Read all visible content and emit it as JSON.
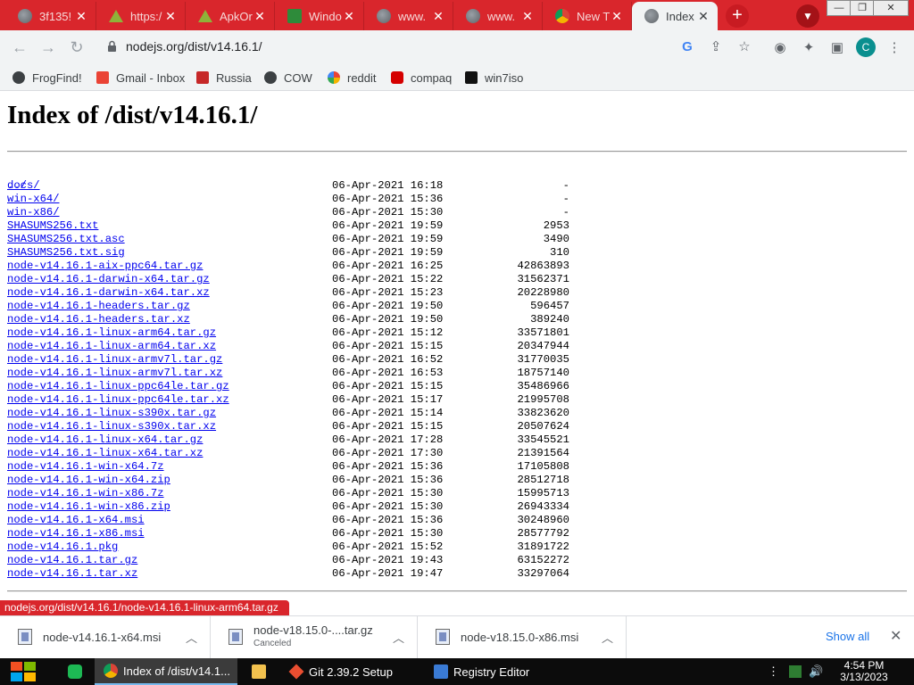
{
  "browser": {
    "tabs": [
      {
        "title": "3f135!",
        "icon": "globe-icon",
        "active": false
      },
      {
        "title": "https:/",
        "icon": "apk-icon",
        "active": false
      },
      {
        "title": "ApkOr",
        "icon": "apk-icon",
        "active": false
      },
      {
        "title": "Windo",
        "icon": "windows-icon",
        "active": false
      },
      {
        "title": "www.",
        "icon": "globe-icon",
        "active": false
      },
      {
        "title": "www.",
        "icon": "globe-icon",
        "active": false
      },
      {
        "title": "New T",
        "icon": "chrome-icon",
        "active": false
      },
      {
        "title": "Index",
        "icon": "globe-icon",
        "active": true
      }
    ],
    "url": "nodejs.org/dist/v14.16.1/",
    "profile_initial": "C",
    "bookmarks": [
      {
        "label": "FrogFind!",
        "icon": "globe-icon",
        "color": "#3c4043"
      },
      {
        "label": "Gmail - Inbox",
        "icon": "gmail-icon",
        "color": "#ea4335"
      },
      {
        "label": "Russia",
        "icon": "flag-icon",
        "color": "#c62828"
      },
      {
        "label": "COW",
        "icon": "globe-icon",
        "color": "#3c4043"
      },
      {
        "label": "reddit",
        "icon": "rainbow-icon",
        "color": "#f4b400"
      },
      {
        "label": "compaq",
        "icon": "compaq-icon",
        "color": "#d50000"
      },
      {
        "label": "win7iso",
        "icon": "tw-icon",
        "color": "#111111"
      }
    ]
  },
  "page": {
    "title": "Index of /dist/v14.16.1/",
    "parent_link": "../",
    "files": [
      {
        "name": "docs/",
        "date": "06-Apr-2021 16:18",
        "size": "-"
      },
      {
        "name": "win-x64/",
        "date": "06-Apr-2021 15:36",
        "size": "-"
      },
      {
        "name": "win-x86/",
        "date": "06-Apr-2021 15:30",
        "size": "-"
      },
      {
        "name": "SHASUMS256.txt",
        "date": "06-Apr-2021 19:59",
        "size": "2953"
      },
      {
        "name": "SHASUMS256.txt.asc",
        "date": "06-Apr-2021 19:59",
        "size": "3490"
      },
      {
        "name": "SHASUMS256.txt.sig",
        "date": "06-Apr-2021 19:59",
        "size": "310"
      },
      {
        "name": "node-v14.16.1-aix-ppc64.tar.gz",
        "date": "06-Apr-2021 16:25",
        "size": "42863893"
      },
      {
        "name": "node-v14.16.1-darwin-x64.tar.gz",
        "date": "06-Apr-2021 15:22",
        "size": "31562371"
      },
      {
        "name": "node-v14.16.1-darwin-x64.tar.xz",
        "date": "06-Apr-2021 15:23",
        "size": "20228980"
      },
      {
        "name": "node-v14.16.1-headers.tar.gz",
        "date": "06-Apr-2021 19:50",
        "size": "596457"
      },
      {
        "name": "node-v14.16.1-headers.tar.xz",
        "date": "06-Apr-2021 19:50",
        "size": "389240"
      },
      {
        "name": "node-v14.16.1-linux-arm64.tar.gz",
        "date": "06-Apr-2021 15:12",
        "size": "33571801"
      },
      {
        "name": "node-v14.16.1-linux-arm64.tar.xz",
        "date": "06-Apr-2021 15:15",
        "size": "20347944"
      },
      {
        "name": "node-v14.16.1-linux-armv7l.tar.gz",
        "date": "06-Apr-2021 16:52",
        "size": "31770035"
      },
      {
        "name": "node-v14.16.1-linux-armv7l.tar.xz",
        "date": "06-Apr-2021 16:53",
        "size": "18757140"
      },
      {
        "name": "node-v14.16.1-linux-ppc64le.tar.gz",
        "date": "06-Apr-2021 15:15",
        "size": "35486966"
      },
      {
        "name": "node-v14.16.1-linux-ppc64le.tar.xz",
        "date": "06-Apr-2021 15:17",
        "size": "21995708"
      },
      {
        "name": "node-v14.16.1-linux-s390x.tar.gz",
        "date": "06-Apr-2021 15:14",
        "size": "33823620"
      },
      {
        "name": "node-v14.16.1-linux-s390x.tar.xz",
        "date": "06-Apr-2021 15:15",
        "size": "20507624"
      },
      {
        "name": "node-v14.16.1-linux-x64.tar.gz",
        "date": "06-Apr-2021 17:28",
        "size": "33545521"
      },
      {
        "name": "node-v14.16.1-linux-x64.tar.xz",
        "date": "06-Apr-2021 17:30",
        "size": "21391564"
      },
      {
        "name": "node-v14.16.1-win-x64.7z",
        "date": "06-Apr-2021 15:36",
        "size": "17105808"
      },
      {
        "name": "node-v14.16.1-win-x64.zip",
        "date": "06-Apr-2021 15:36",
        "size": "28512718"
      },
      {
        "name": "node-v14.16.1-win-x86.7z",
        "date": "06-Apr-2021 15:30",
        "size": "15995713"
      },
      {
        "name": "node-v14.16.1-win-x86.zip",
        "date": "06-Apr-2021 15:30",
        "size": "26943334"
      },
      {
        "name": "node-v14.16.1-x64.msi",
        "date": "06-Apr-2021 15:36",
        "size": "30248960"
      },
      {
        "name": "node-v14.16.1-x86.msi",
        "date": "06-Apr-2021 15:30",
        "size": "28577792"
      },
      {
        "name": "node-v14.16.1.pkg",
        "date": "06-Apr-2021 15:52",
        "size": "31891722"
      },
      {
        "name": "node-v14.16.1.tar.gz",
        "date": "06-Apr-2021 19:43",
        "size": "63152272"
      },
      {
        "name": "node-v14.16.1.tar.xz",
        "date": "06-Apr-2021 19:47",
        "size": "33297064"
      }
    ]
  },
  "status_url": "nodejs.org/dist/v14.16.1/node-v14.16.1-linux-arm64.tar.gz",
  "downloads": {
    "items": [
      {
        "name": "node-v14.16.1-x64.msi",
        "status": ""
      },
      {
        "name": "node-v18.15.0-....tar.gz",
        "status": "Canceled"
      },
      {
        "name": "node-v18.15.0-x86.msi",
        "status": ""
      }
    ],
    "show_all": "Show all"
  },
  "taskbar": {
    "tasks": [
      {
        "label": "Index of /dist/v14.1...",
        "icon": "chrome-icon",
        "active": true
      },
      {
        "label": "",
        "icon": "folder-icon",
        "active": false
      },
      {
        "label": "Git 2.39.2 Setup",
        "icon": "git-icon",
        "active": false
      },
      {
        "label": "Registry Editor",
        "icon": "registry-icon",
        "active": false
      }
    ],
    "time": "4:54 PM",
    "date": "3/13/2023"
  }
}
